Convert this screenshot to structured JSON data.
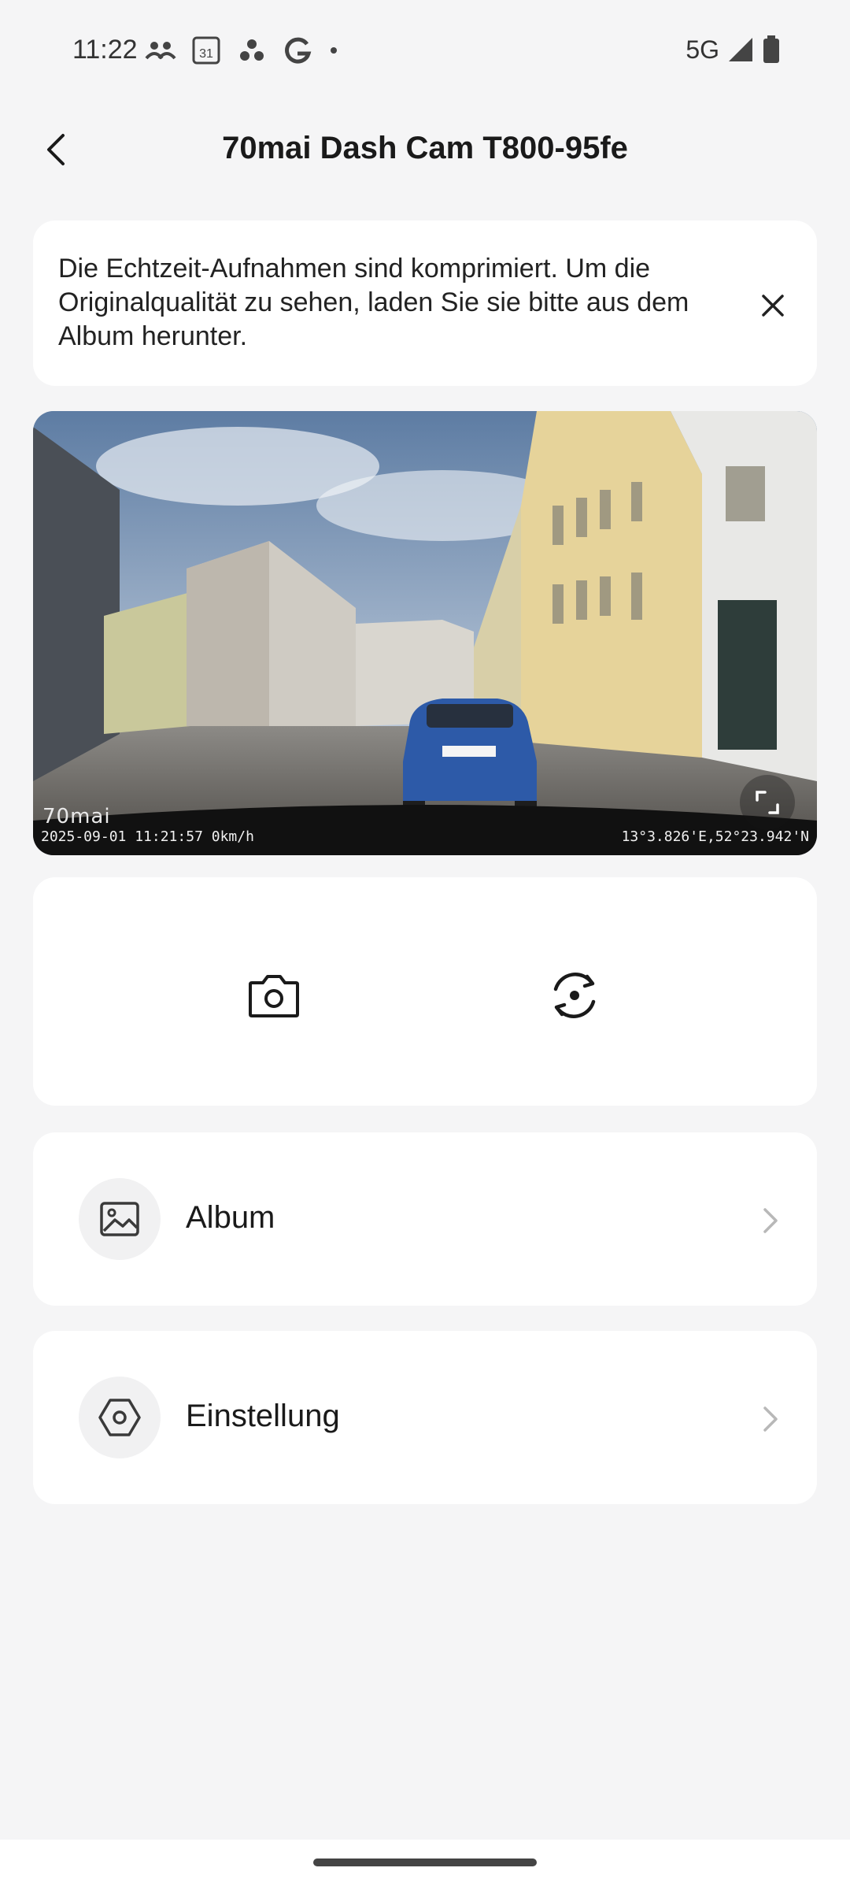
{
  "status_bar": {
    "time": "11:22",
    "calendar_day": "31",
    "network": "5G",
    "icons": [
      "people-icon",
      "calendar-icon",
      "dots-icon",
      "google-icon",
      "notification-dot-icon",
      "signal-icon",
      "battery-icon"
    ]
  },
  "header": {
    "title": "70mai Dash Cam T800-95fe",
    "back_icon": "chevron-left-icon"
  },
  "notice": {
    "text": "Die Echtzeit-Aufnahmen sind komprimiert. Um die Originalqualität zu sehen, laden Sie sie bitte aus dem Album herunter.",
    "close_icon": "close-icon"
  },
  "video": {
    "watermark_logo": "70mai",
    "overlay_left": "2025-09-01 11:21:57 0km/h",
    "overlay_right": "13°3.826'E,52°23.942'N",
    "fullscreen_icon": "fullscreen-icon"
  },
  "controls": {
    "photo_icon": "camera-icon",
    "switch_icon": "switch-camera-icon"
  },
  "menu": {
    "album": {
      "label": "Album",
      "icon": "image-icon"
    },
    "settings": {
      "label": "Einstellung",
      "icon": "settings-hexagon-icon"
    }
  },
  "colors": {
    "background": "#f5f5f6",
    "card": "#ffffff",
    "text": "#1a1a1a",
    "chevron": "#b8b8b8"
  }
}
